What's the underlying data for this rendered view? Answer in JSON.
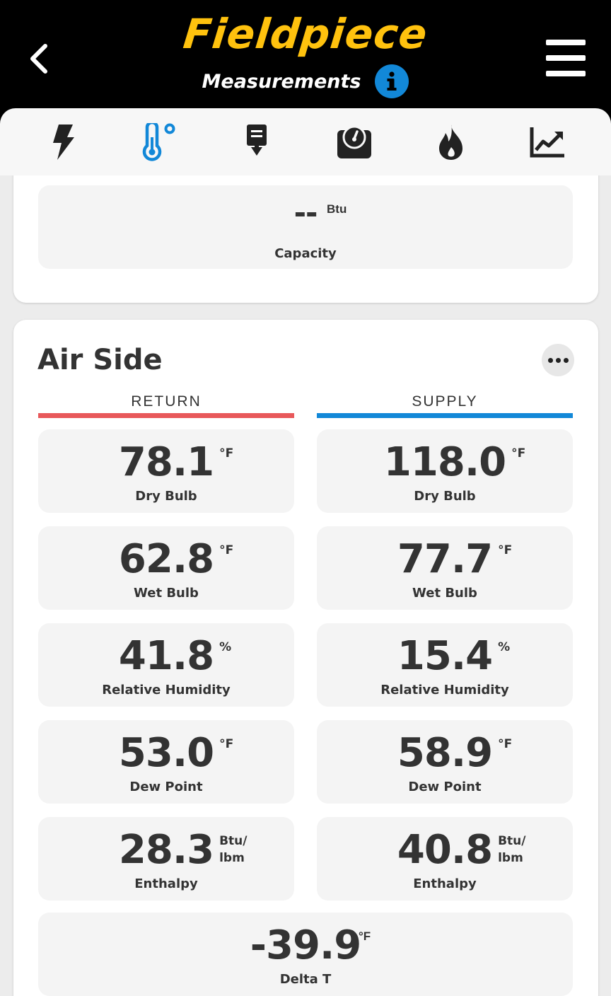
{
  "header": {
    "logo": "Fieldpiece",
    "subtitle": "Measurements",
    "info_glyph": "i"
  },
  "icons": {
    "back": "chevron-left-icon",
    "info": "info-icon",
    "menu": "hamburger-menu-icon"
  },
  "tabs": [
    {
      "icon": "lightning-icon",
      "active": false
    },
    {
      "icon": "thermometer-icon",
      "active": true
    },
    {
      "icon": "probe-download-icon",
      "active": false
    },
    {
      "icon": "gauge-icon",
      "active": false
    },
    {
      "icon": "flame-icon",
      "active": false
    },
    {
      "icon": "trend-chart-icon",
      "active": false
    }
  ],
  "colors": {
    "header_bg": "#000000",
    "logo": "#ffc20e",
    "accent_blue": "#1288d8",
    "return_bar": "#e8585a",
    "supply_bar": "#1288d8"
  },
  "capacity": {
    "value": "--",
    "unit": "Btu",
    "label": "Capacity"
  },
  "air_side": {
    "title": "Air Side",
    "return_label": "RETURN",
    "supply_label": "SUPPLY",
    "return": [
      {
        "value": "78.1",
        "unit": "°F",
        "label": "Dry Bulb"
      },
      {
        "value": "62.8",
        "unit": "°F",
        "label": "Wet Bulb"
      },
      {
        "value": "41.8",
        "unit": "%",
        "label": "Relative Humidity"
      },
      {
        "value": "53.0",
        "unit": "°F",
        "label": "Dew Point"
      },
      {
        "value": "28.3",
        "unit": "Btu/\nlbm",
        "label": "Enthalpy"
      }
    ],
    "supply": [
      {
        "value": "118.0",
        "unit": "°F",
        "label": "Dry Bulb"
      },
      {
        "value": "77.7",
        "unit": "°F",
        "label": "Wet Bulb"
      },
      {
        "value": "15.4",
        "unit": "%",
        "label": "Relative Humidity"
      },
      {
        "value": "58.9",
        "unit": "°F",
        "label": "Dew Point"
      },
      {
        "value": "40.8",
        "unit": "Btu/\nlbm",
        "label": "Enthalpy"
      }
    ],
    "delta_t": {
      "value": "-39.9",
      "unit": "°F",
      "label": "Delta T"
    }
  }
}
